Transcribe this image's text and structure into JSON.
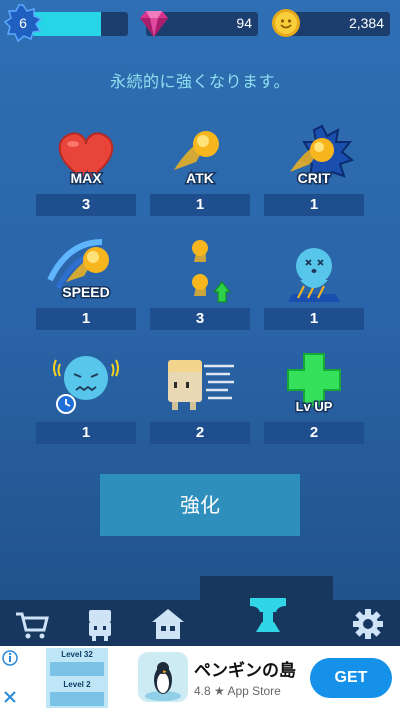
{
  "header": {
    "level": "6",
    "xp_progress": 0.72,
    "gems": "94",
    "coins": "2,384"
  },
  "subtitle": "永続的に強くなります。",
  "upgrades": [
    {
      "label": "MAX",
      "value": "3",
      "icon": "heart-icon"
    },
    {
      "label": "ATK",
      "value": "1",
      "icon": "fireball-icon"
    },
    {
      "label": "CRIT",
      "value": "1",
      "icon": "crit-fireball-icon"
    },
    {
      "label": "SPEED",
      "value": "1",
      "icon": "speed-fireball-icon"
    },
    {
      "label": "",
      "value": "3",
      "icon": "multi-shot-icon"
    },
    {
      "label": "",
      "value": "1",
      "icon": "stunned-enemy-icon"
    },
    {
      "label": "",
      "value": "1",
      "icon": "frozen-enemy-timer-icon"
    },
    {
      "label": "",
      "value": "2",
      "icon": "dash-character-icon"
    },
    {
      "label": "Lv UP",
      "value": "2",
      "icon": "level-up-cross-icon"
    }
  ],
  "upgrade_button": "強化",
  "nav": {
    "items": [
      "cart-icon",
      "character-icon",
      "home-icon",
      "anvil-icon",
      "gear-icon"
    ],
    "active": "anvil-icon"
  },
  "ad": {
    "thumb_labels": [
      "Level 32",
      "Level 2"
    ],
    "title": "ペンギンの島",
    "rating": "4.8 ★ App Store",
    "cta": "GET"
  },
  "colors": {
    "accent": "#26d6e6",
    "button": "#2f8fbc",
    "nav": "#17375f",
    "cta": "#1591ea"
  }
}
